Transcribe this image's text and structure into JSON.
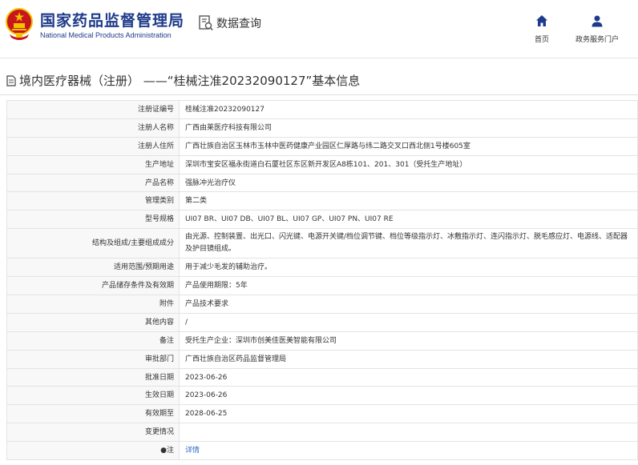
{
  "header": {
    "brand_cn": "国家药品监督管理局",
    "brand_en": "National Medical Products Administration",
    "query_label": "数据查询",
    "nav": {
      "home": "首页",
      "portal": "政务服务门户"
    }
  },
  "title": "境内医疗器械（注册） ——“桂械注准20232090127”基本信息",
  "rows": [
    {
      "key": "注册证编号",
      "value": "桂械注准20232090127"
    },
    {
      "key": "注册人名称",
      "value": "广西由莱医疗科技有限公司"
    },
    {
      "key": "注册人住所",
      "value": "广西壮族自治区玉林市玉林中医药健康产业园区仁厚路与纬二路交叉口西北侧1号楼605室"
    },
    {
      "key": "生产地址",
      "value": "深圳市宝安区福永街道白石厦社区东区新开发区A8栋101、201、301（受托生产地址）"
    },
    {
      "key": "产品名称",
      "value": "强脉冲光治疗仪"
    },
    {
      "key": "管理类别",
      "value": "第二类"
    },
    {
      "key": "型号规格",
      "value": "UI07 BR、UI07 DB、UI07 BL、UI07 GP、UI07 PN、UI07 RE"
    },
    {
      "key": "结构及组成/主要组成成分",
      "value": "由光源、控制装置、出光口、闪光键、电源开关键/档位调节键、档位等级指示灯、冰敷指示灯、连闪指示灯、脱毛感应灯、电源线、适配器及护目镜组成。"
    },
    {
      "key": "适用范围/预期用途",
      "value": "用于减少毛发的辅助治疗。"
    },
    {
      "key": "产品储存条件及有效期",
      "value": "产品使用期限：5年"
    },
    {
      "key": "附件",
      "value": "产品技术要求"
    },
    {
      "key": "其他内容",
      "value": "/"
    },
    {
      "key": "备注",
      "value": "受托生产企业：深圳市创美佳医美智能有限公司"
    },
    {
      "key": "审批部门",
      "value": "广西壮族自治区药品监督管理局"
    },
    {
      "key": "批准日期",
      "value": "2023-06-26"
    },
    {
      "key": "生效日期",
      "value": "2023-06-26"
    },
    {
      "key": "有效期至",
      "value": "2028-06-25"
    },
    {
      "key": "变更情况",
      "value": ""
    },
    {
      "key": "注",
      "value": "详情"
    }
  ],
  "pin_symbol": "●",
  "colors": {
    "brand": "#1e3a8a",
    "link": "#2b6cc4",
    "emblem_red": "#c8161d",
    "emblem_gold": "#f2c200"
  },
  "icons": {
    "emblem": "national-emblem-icon",
    "query": "data-search-icon",
    "home": "home-icon",
    "portal": "user-icon",
    "title": "document-icon"
  }
}
